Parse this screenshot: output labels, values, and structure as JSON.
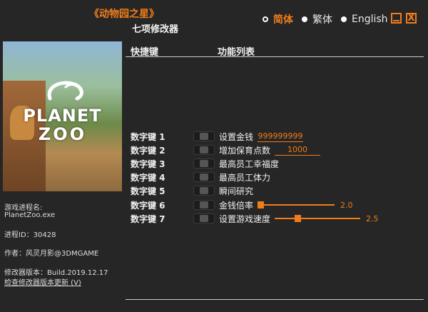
{
  "header": {
    "title": "《动物园之星》",
    "subtitle": "七项修改器",
    "languages": [
      {
        "label": "简体",
        "selected": true
      },
      {
        "label": "繁体",
        "selected": false
      },
      {
        "label": "English",
        "selected": false
      }
    ],
    "minimize_icon": "minimize-icon",
    "close_label": "X"
  },
  "cover": {
    "line1": "PLANET",
    "line2": "ZOO"
  },
  "info": {
    "process_label": "游戏进程名:",
    "process_name": "PlanetZoo.exe",
    "pid": "进程ID：30428",
    "author": "作者：风灵月影@3DMGAME",
    "version": "修改器版本：Build.2019.12.17",
    "update_link": "检查修改器版本更新 (V)"
  },
  "table": {
    "col_hotkey": "快捷键",
    "col_function": "功能列表",
    "rows": [
      {
        "key": "数字键 1",
        "name": "设置金钱",
        "value": "999999999"
      },
      {
        "key": "数字键 2",
        "name": "增加保育点数",
        "value": "1000"
      },
      {
        "key": "数字键 3",
        "name": "最高员工幸福度"
      },
      {
        "key": "数字键 4",
        "name": "最高员工体力"
      },
      {
        "key": "数字键 5",
        "name": "瞬间研究"
      },
      {
        "key": "数字键 6",
        "name": "金钱倍率",
        "slider_value": "2.0"
      },
      {
        "key": "数字键 7",
        "name": "设置游戏速度",
        "slider_value": "2.5"
      }
    ]
  },
  "colors": {
    "accent": "#f07d1a",
    "background": "#262626"
  }
}
